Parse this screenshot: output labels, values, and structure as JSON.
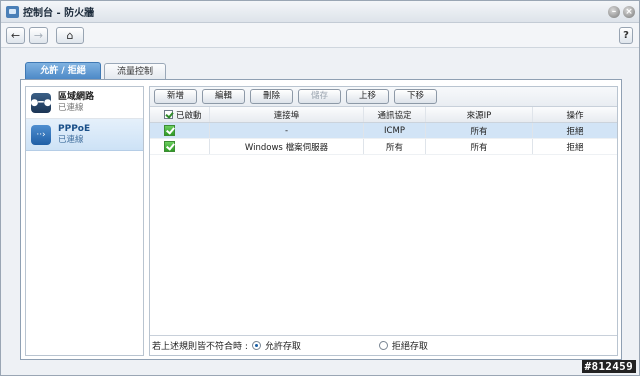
{
  "window": {
    "title": "控制台 - 防火牆"
  },
  "toolbar": {
    "back_label": "←",
    "forward_label": "→",
    "home_label": "⌂",
    "help_label": "?"
  },
  "tabs": [
    {
      "label": "允許 / 拒絕"
    },
    {
      "label": "流量控制"
    }
  ],
  "sidebar": {
    "items": [
      {
        "name": "區域網路",
        "status": "已連線"
      },
      {
        "name": "PPPoE",
        "status": "已連線"
      }
    ]
  },
  "actions": {
    "add": "新增",
    "edit": "編輯",
    "delete": "刪除",
    "save": "儲存",
    "move_up": "上移",
    "move_down": "下移"
  },
  "table": {
    "headers": [
      "已啟動",
      "連接埠",
      "通訊協定",
      "來源IP",
      "操作"
    ],
    "rows": [
      {
        "enabled": true,
        "port": "-",
        "protocol": "ICMP",
        "source_ip": "所有",
        "action": "拒絕"
      },
      {
        "enabled": true,
        "port": "Windows 檔案伺服器",
        "protocol": "所有",
        "source_ip": "所有",
        "action": "拒絕"
      }
    ]
  },
  "footer": {
    "prompt": "若上述規則皆不符合時 :",
    "allow_label": "允許存取",
    "deny_label": "拒絕存取",
    "selected": "allow"
  },
  "watermark": "#812459"
}
